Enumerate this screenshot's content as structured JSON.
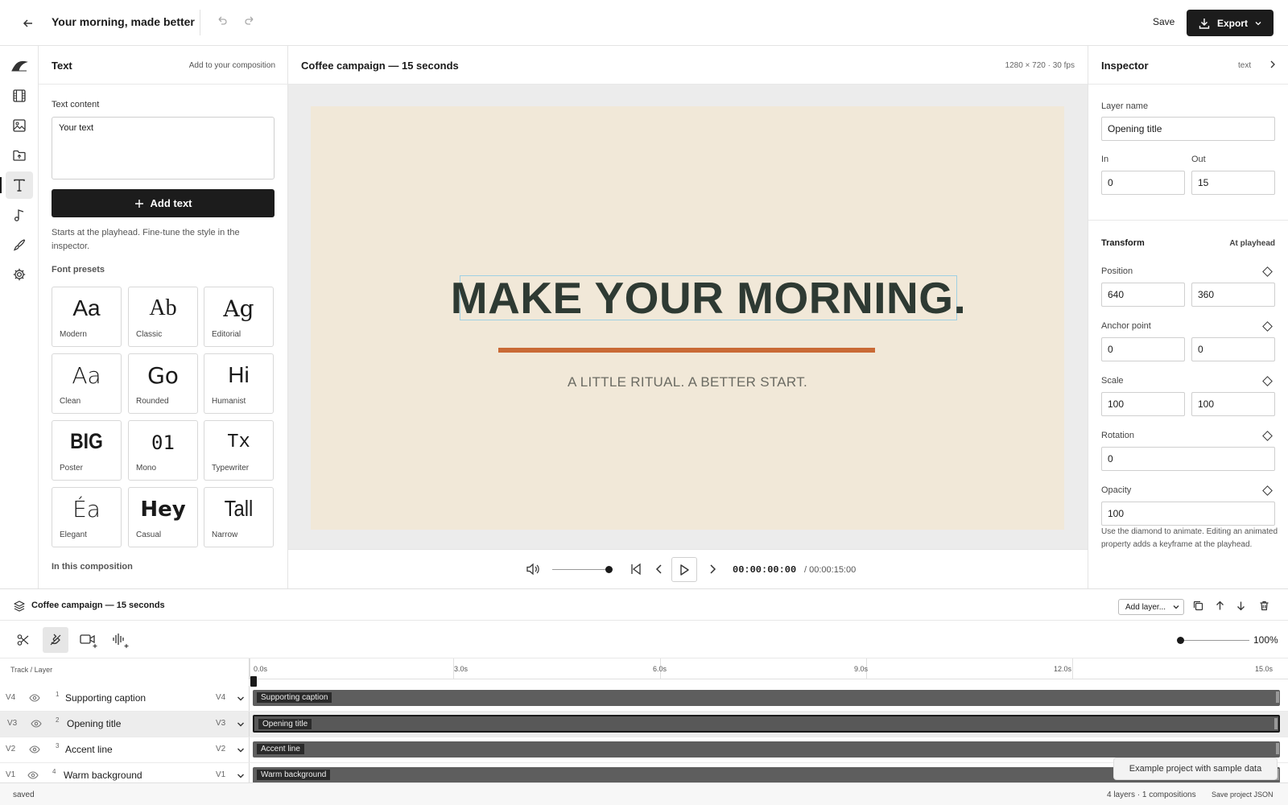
{
  "topbar": {
    "title": "Your morning, made better",
    "save_label": "Save",
    "export_label": "Export"
  },
  "rail": {
    "items": [
      "logo-icon",
      "film-icon",
      "image-icon",
      "upload-folder-icon",
      "text-icon",
      "music-icon",
      "brush-icon",
      "gear-icon"
    ],
    "active": "text-icon"
  },
  "text_panel": {
    "title": "Text",
    "subtitle": "Add to your composition",
    "content_label": "Text content",
    "content_value": "Your text",
    "add_button": "Add text",
    "hint": "Starts at the playhead. Fine-tune the style in the inspector.",
    "presets_title": "Font presets",
    "presets": [
      {
        "glyph": "Aa",
        "label": "Modern"
      },
      {
        "glyph": "Ab",
        "label": "Classic"
      },
      {
        "glyph": "Ag",
        "label": "Editorial"
      },
      {
        "glyph": "Aa",
        "label": "Clean"
      },
      {
        "glyph": "Go",
        "label": "Rounded"
      },
      {
        "glyph": "Hi",
        "label": "Humanist"
      },
      {
        "glyph": "BIG",
        "label": "Poster"
      },
      {
        "glyph": "01",
        "label": "Mono"
      },
      {
        "glyph": "Tx",
        "label": "Typewriter"
      },
      {
        "glyph": "Éa",
        "label": "Elegant"
      },
      {
        "glyph": "Hey",
        "label": "Casual"
      },
      {
        "glyph": "Tall",
        "label": "Narrow"
      }
    ],
    "in_comp_title": "In this composition"
  },
  "canvas": {
    "title": "Coffee campaign — 15 seconds",
    "meta": "1280 × 720 · 30 fps",
    "headline": "MAKE YOUR MORNING.",
    "subline": "A LITTLE RITUAL. A BETTER START.",
    "background_color": "#f1e8d8",
    "headline_color": "#2e3a33",
    "accent_color": "#c96a36",
    "timecode": "00:00:00:00",
    "duration": "/ 00:00:15:00",
    "volume": 1.0
  },
  "inspector": {
    "title": "Inspector",
    "type": "text",
    "layer_name_label": "Layer name",
    "layer_name": "Opening title",
    "in_label": "In",
    "in_value": "0",
    "out_label": "Out",
    "out_value": "15",
    "transform_label": "Transform",
    "at_playhead": "At playhead",
    "position_label": "Position",
    "position_x": "640",
    "position_y": "360",
    "anchor_label": "Anchor point",
    "anchor_x": "0",
    "anchor_y": "0",
    "scale_label": "Scale",
    "scale_x": "100",
    "scale_y": "100",
    "rotation_label": "Rotation",
    "rotation": "0",
    "opacity_label": "Opacity",
    "opacity": "100",
    "note": "Use the diamond to animate. Editing an animated property adds a keyframe at the playhead."
  },
  "timeline": {
    "title": "Coffee campaign — 15 seconds",
    "add_layer": "Add layer...",
    "zoom": "100%",
    "zoom_level": 0.0,
    "track_header": "Track / Layer",
    "ruler": [
      "0.0s",
      "3.0s",
      "6.0s",
      "9.0s",
      "12.0s",
      "15.0s"
    ],
    "tracks": [
      {
        "id": "V4",
        "num": "1",
        "name": "Supporting caption",
        "clip": "Supporting caption"
      },
      {
        "id": "V3",
        "num": "2",
        "name": "Opening title",
        "clip": "Opening title"
      },
      {
        "id": "V2",
        "num": "3",
        "name": "Accent line",
        "clip": "Accent line"
      },
      {
        "id": "V1",
        "num": "4",
        "name": "Warm background",
        "clip": "Warm background"
      }
    ],
    "selected_track": "V3"
  },
  "toast": "Example project with sample data",
  "status": {
    "left": "saved",
    "summary": "4 layers · 1 compositions",
    "save_json": "Save project JSON"
  }
}
